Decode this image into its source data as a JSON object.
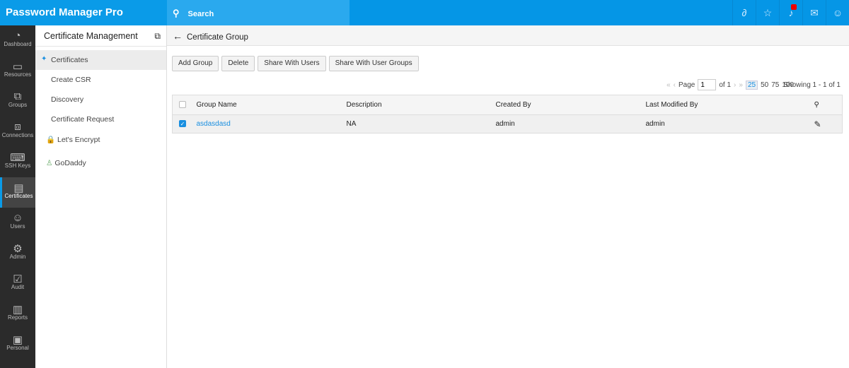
{
  "app": {
    "title": "Password Manager Pro"
  },
  "search": {
    "placeholder": "Search"
  },
  "nav": [
    {
      "label": "Dashboard",
      "icon": "◔"
    },
    {
      "label": "Resources",
      "icon": "▭"
    },
    {
      "label": "Groups",
      "icon": "⧉"
    },
    {
      "label": "Connections",
      "icon": "⧈"
    },
    {
      "label": "SSH Keys",
      "icon": "⌨"
    },
    {
      "label": "Certificates",
      "icon": "▤"
    },
    {
      "label": "Users",
      "icon": "☺"
    },
    {
      "label": "Admin",
      "icon": "⚙"
    },
    {
      "label": "Audit",
      "icon": "☑"
    },
    {
      "label": "Reports",
      "icon": "▥"
    },
    {
      "label": "Personal",
      "icon": "▣"
    }
  ],
  "side": {
    "title": "Certificate Management",
    "items": [
      "Certificates",
      "Create CSR",
      "Discovery",
      "Certificate Request",
      "Let's Encrypt",
      "GoDaddy"
    ]
  },
  "header": {
    "title": "Certificate Group"
  },
  "toolbar": {
    "add": "Add Group",
    "delete": "Delete",
    "share_users": "Share With Users",
    "share_groups": "Share With User Groups"
  },
  "pager": {
    "page_label": "Page",
    "page": "1",
    "of": "of 1",
    "sizes": [
      "25",
      "50",
      "75",
      "100"
    ],
    "showing": "Showing 1 - 1 of 1"
  },
  "table": {
    "headers": [
      "Group Name",
      "Description",
      "Created By",
      "Last Modified By"
    ],
    "rows": [
      {
        "name": "asdasdasd",
        "description": "NA",
        "created_by": "admin",
        "modified_by": "admin"
      }
    ]
  }
}
